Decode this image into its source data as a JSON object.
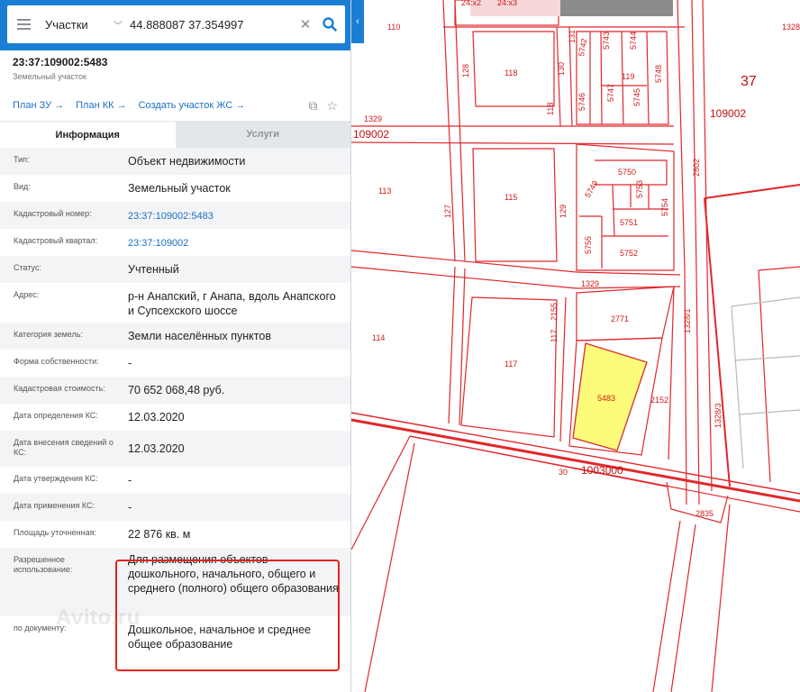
{
  "search": {
    "layer": "Участки",
    "query": "44.888087 37.354997"
  },
  "object": {
    "cad_number": "23:37:109002:5483",
    "kind": "Земельный участок"
  },
  "actions": [
    "План ЗУ →",
    "План КК →",
    "Создать участок ЖС →"
  ],
  "tabs": {
    "info": "Информация",
    "services": "Услуги"
  },
  "properties": [
    {
      "label": "Тип:",
      "value": "Объект недвижимости"
    },
    {
      "label": "Вид:",
      "value": "Земельный участок"
    },
    {
      "label": "Кадастровый номер:",
      "value": "23:37:109002:5483",
      "link": true
    },
    {
      "label": "Кадастровый квартал:",
      "value": "23:37:109002",
      "link": true
    },
    {
      "label": "Статус:",
      "value": "Учтенный"
    },
    {
      "label": "Адрес:",
      "value": "р-н Анапский, г Анапа, вдоль Анапского и Супсехского шоссе"
    },
    {
      "label": "Категория земель:",
      "value": "Земли населённых пунктов"
    },
    {
      "label": "Форма собственности:",
      "value": "-"
    },
    {
      "label": "Кадастровая стоимость:",
      "value": "70 652 068,48 руб."
    },
    {
      "label": "Дата определения КС:",
      "value": "12.03.2020"
    },
    {
      "label": "Дата внесения сведений о КС:",
      "value": "12.03.2020"
    },
    {
      "label": "Дата утверждения КС:",
      "value": "-"
    },
    {
      "label": "Дата применения КС:",
      "value": "-"
    },
    {
      "label": "Площадь уточненная:",
      "value": "22 876 кв. м"
    },
    {
      "label": "Разрешенное использование:",
      "value": "Для размещения объектов дошкольного, начального, общего и среднего (полного) общего образования"
    },
    {
      "label": "по документу:",
      "value": "Дошкольное, начальное и среднее общее образование"
    }
  ],
  "watermark": "Avito.ru",
  "map": {
    "labels": [
      "110",
      "1328",
      "37",
      "109002",
      "1329",
      "109002",
      "113",
      "118",
      "128",
      "130",
      "131",
      "5742",
      "5743",
      "5744",
      "119",
      "5748",
      "118",
      "5746",
      "5747",
      "5745",
      "2802",
      "5750",
      "5749",
      "5753",
      "115",
      "127",
      "129",
      "5751",
      "5754",
      "5755",
      "5752",
      "1329",
      "114",
      "117",
      "2155",
      "2771",
      "1328/1",
      "117",
      "5483",
      "2152",
      "1328/3",
      "30",
      "1003000",
      "2835",
      "24:x2",
      "24:x3"
    ],
    "colors": {
      "line": "#e0282c",
      "selected_fill": "#fdfc7a",
      "selected_stroke": "#d62a2a"
    }
  }
}
